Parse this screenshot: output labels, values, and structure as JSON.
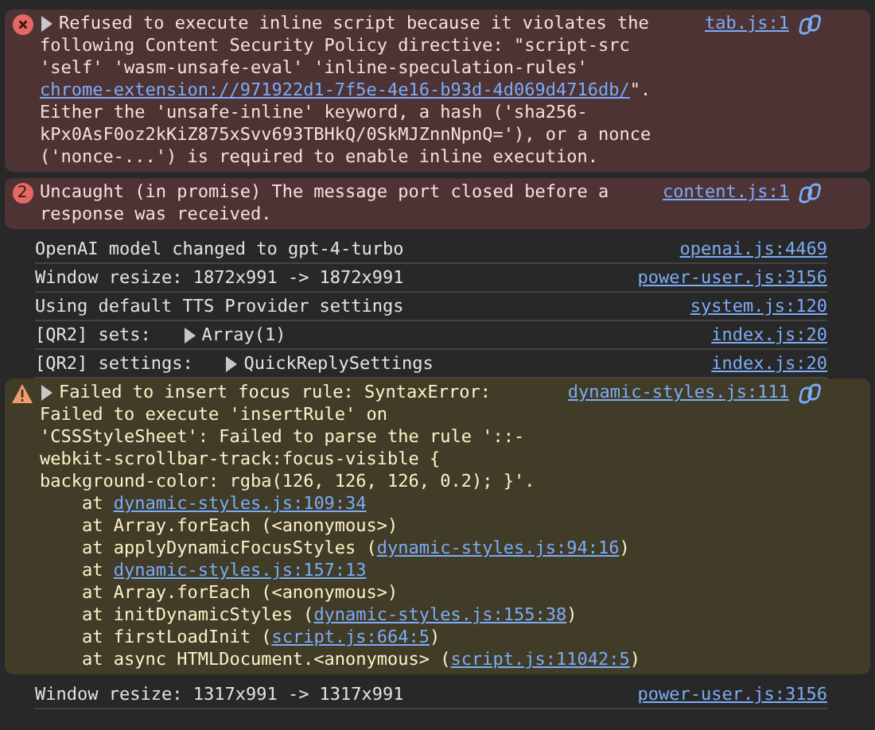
{
  "messages": [
    {
      "kind": "error",
      "expandable": true,
      "parts": [
        {
          "t": "Refused to execute inline script because it violates the following Content Security Policy directive: \"script-src 'self' 'wasm-unsafe-eval' 'inline-speculation-rules' "
        },
        {
          "link": "chrome-extension://971922d1-7f5e-4e16-b93d-4d069d4716db/"
        },
        {
          "t": "\". Either the 'unsafe-inline' keyword, a hash ('sha256-kPx0AsF0oz2kKiZ875xSvv693TBHkQ/0SkMJZnnNpnQ='), or a nonce ('nonce-...') is required to enable inline execution."
        }
      ],
      "source": "tab.js:1",
      "assist": true
    },
    {
      "kind": "error",
      "count": "2",
      "parts": [
        {
          "t": "Uncaught (in promise) The message port closed before a response was received."
        }
      ],
      "source": "content.js:1",
      "assist": true
    },
    {
      "kind": "log",
      "parts": [
        {
          "t": "OpenAI model changed to gpt-4-turbo"
        }
      ],
      "source": "openai.js:4469"
    },
    {
      "kind": "log",
      "parts": [
        {
          "t": "Window resize: 1872x991 -> 1872x991"
        }
      ],
      "source": "power-user.js:3156"
    },
    {
      "kind": "log",
      "parts": [
        {
          "t": "Using default TTS Provider settings"
        }
      ],
      "source": "system.js:120"
    },
    {
      "kind": "log",
      "parts": [
        {
          "t": "[QR2] sets: "
        }
      ],
      "object": "Array(1)",
      "source": "index.js:20"
    },
    {
      "kind": "log",
      "parts": [
        {
          "t": "[QR2] settings: "
        }
      ],
      "object": "QuickReplySettings",
      "source": "index.js:20"
    },
    {
      "kind": "warning",
      "expandable": true,
      "parts": [
        {
          "t": "Failed to insert focus rule: SyntaxError:\nFailed to execute 'insertRule' on 'CSSStyleSheet': Failed to parse the rule '::-webkit-scrollbar-track:focus-visible { background-color: rgba(126, 126, 126, 0.2); }'."
        }
      ],
      "source": "dynamic-styles.js:111",
      "assist": true,
      "stack": [
        {
          "at": "at",
          "link": "dynamic-styles.js:109:34"
        },
        {
          "at": "at",
          "fn": "Array.forEach (<anonymous>)"
        },
        {
          "at": "at",
          "fn": "applyDynamicFocusStyles (",
          "link": "dynamic-styles.js:94:16",
          "close": ")"
        },
        {
          "at": "at",
          "link": "dynamic-styles.js:157:13"
        },
        {
          "at": "at",
          "fn": "Array.forEach (<anonymous>)"
        },
        {
          "at": "at",
          "fn": "initDynamicStyles (",
          "link": "dynamic-styles.js:155:38",
          "close": ")"
        },
        {
          "at": "at",
          "fn": "firstLoadInit (",
          "link": "script.js:664:5",
          "close": ")"
        },
        {
          "at": "at",
          "fn": "async HTMLDocument.<anonymous> (",
          "link": "script.js:11042:5",
          "close": ")"
        }
      ]
    },
    {
      "kind": "log",
      "parts": [
        {
          "t": "Window resize: 1317x991 -> 1317x991"
        }
      ],
      "source": "power-user.js:3156"
    }
  ]
}
